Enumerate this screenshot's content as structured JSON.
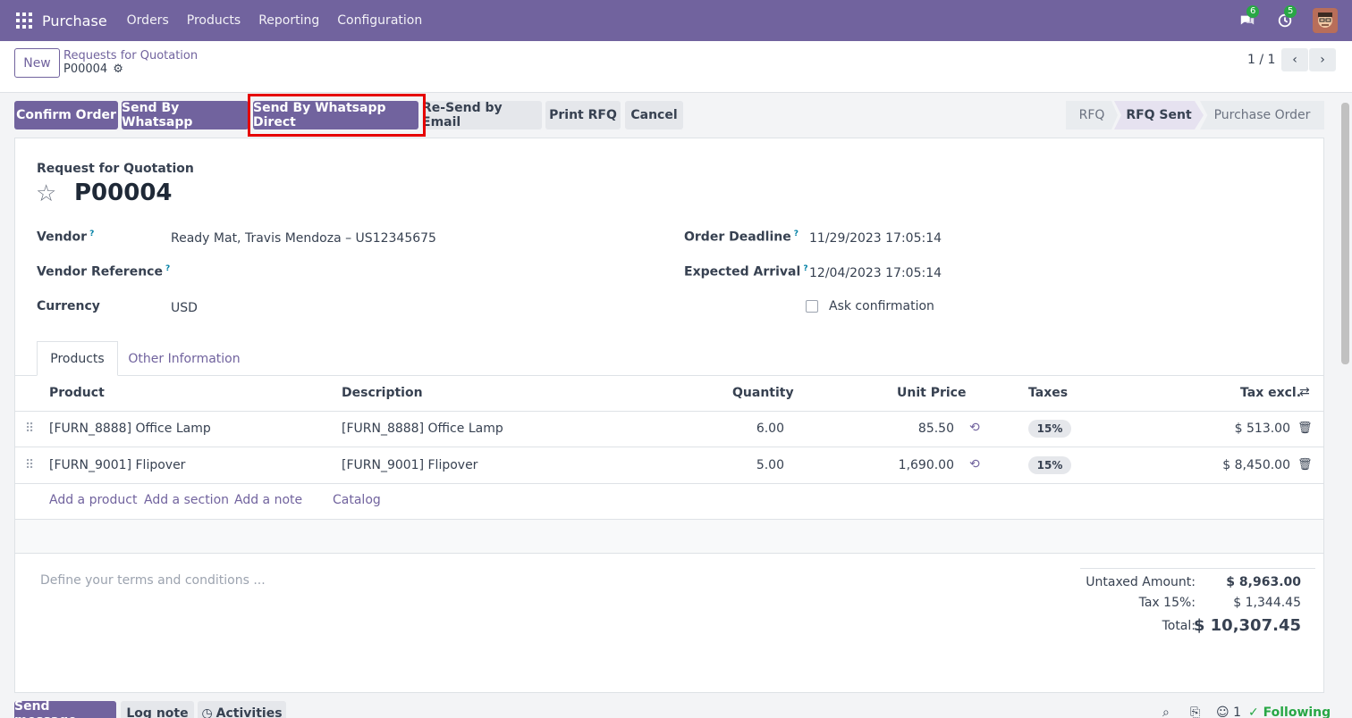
{
  "navbar": {
    "app_name": "Purchase",
    "menus": [
      "Orders",
      "Products",
      "Reporting",
      "Configuration"
    ],
    "messages_count": "6",
    "activities_count": "5"
  },
  "control_panel": {
    "new_label": "New",
    "breadcrumb": "Requests for Quotation",
    "record_name": "P00004",
    "pager": "1 / 1"
  },
  "actions": {
    "confirm": "Confirm Order",
    "whatsapp": "Send By Whatsapp",
    "whatsapp_direct": "Send By Whatsapp Direct",
    "resend_email": "Re-Send by Email",
    "print_rfq": "Print RFQ",
    "cancel": "Cancel"
  },
  "stages": [
    "RFQ",
    "RFQ Sent",
    "Purchase Order"
  ],
  "form": {
    "title_label": "Request for Quotation",
    "name": "P00004",
    "vendor_label": "Vendor",
    "vendor_value": "Ready Mat, Travis Mendoza – US12345675",
    "vendor_ref_label": "Vendor Reference",
    "currency_label": "Currency",
    "currency_value": "USD",
    "deadline_label": "Order Deadline",
    "deadline_value": "11/29/2023 17:05:14",
    "arrival_label": "Expected Arrival",
    "arrival_value": "12/04/2023 17:05:14",
    "ask_confirmation": "Ask confirmation",
    "help_mark": "?"
  },
  "tabs": [
    "Products",
    "Other Information"
  ],
  "table": {
    "headers": [
      "Product",
      "Description",
      "Quantity",
      "Unit Price",
      "Taxes",
      "Tax excl."
    ],
    "rows": [
      {
        "product": "[FURN_8888] Office Lamp",
        "description": "[FURN_8888] Office Lamp",
        "quantity": "6.00",
        "unit_price": "85.50",
        "taxes": "15%",
        "subtotal": "$ 513.00"
      },
      {
        "product": "[FURN_9001] Flipover",
        "description": "[FURN_9001] Flipover",
        "quantity": "5.00",
        "unit_price": "1,690.00",
        "taxes": "15%",
        "subtotal": "$ 8,450.00"
      }
    ],
    "add_links": [
      "Add a product",
      "Add a section",
      "Add a note",
      "Catalog"
    ]
  },
  "terms_placeholder": "Define your terms and conditions ...",
  "totals": {
    "untaxed_label": "Untaxed Amount:",
    "untaxed_value": "$ 8,963.00",
    "tax_label": "Tax 15%:",
    "tax_value": "$ 1,344.45",
    "total_label": "Total:",
    "total_value": "$ 10,307.45"
  },
  "chatter": {
    "send_message": "Send message",
    "log_note": "Log note",
    "activities": "Activities",
    "followers_count": "1",
    "following": "Following"
  },
  "colors": {
    "brand": "#71639e",
    "highlight": "#e60000",
    "success": "#28a745"
  }
}
